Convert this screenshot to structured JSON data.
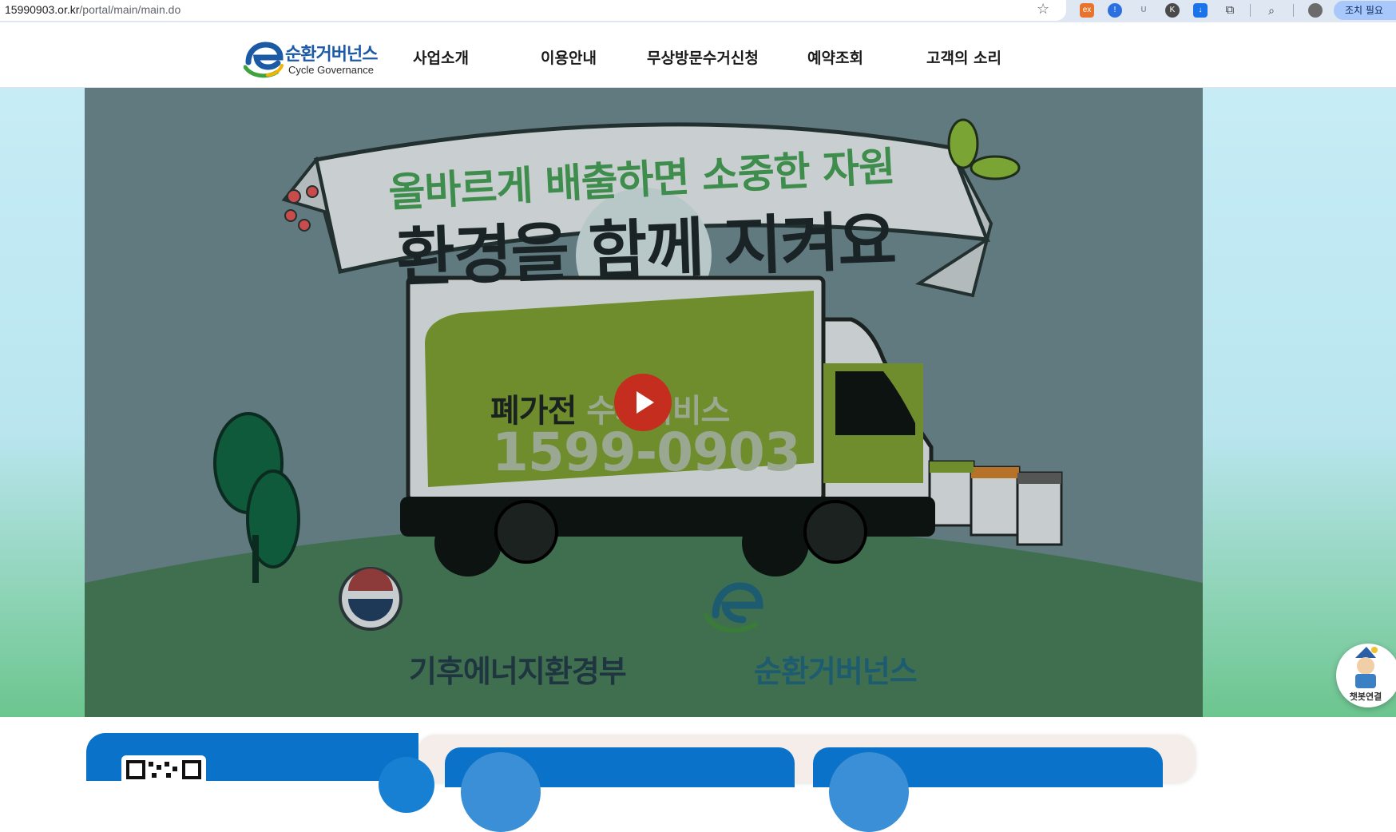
{
  "browser": {
    "url_host": "15990903.or.kr",
    "url_path": "/portal/main/main.do",
    "profile_pill": "조치 필요"
  },
  "header": {
    "logo_text": "순환거버넌스",
    "logo_sub": "Cycle Governance",
    "nav": [
      "사업소개",
      "이용안내",
      "무상방문수거신청",
      "예약조회",
      "고객의 소리"
    ]
  },
  "hero": {
    "banner_line1": "올바르게 배출하면 소중한 자원",
    "banner_line2": "환경을 함께 지켜요",
    "truck_text_dark": "폐가전 ",
    "truck_text_light": "수거서비스",
    "truck_phone": "1599-0903",
    "ministry": "기후에너지환경부",
    "governance": "순환거버넌스"
  },
  "chatbot": {
    "label": "챗봇연결"
  },
  "colors": {
    "brand_blue": "#0a72c8",
    "play_red": "#c52d1f",
    "hero_bg": "#607a80",
    "truck_green": "#7c9d36"
  }
}
